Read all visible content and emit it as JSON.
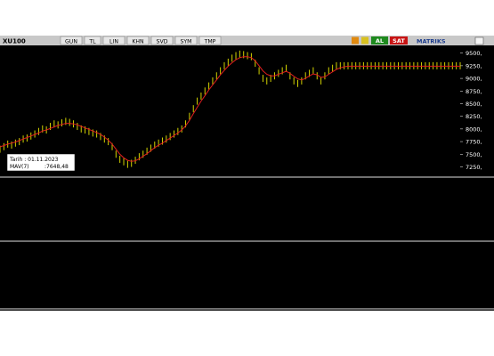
{
  "toolbar": {
    "symbol": "XU100",
    "buttons": [
      "GUN",
      "TL",
      "LIN",
      "KHN",
      "SVD",
      "SYM",
      "TMP"
    ],
    "al_label": "AL",
    "sat_label": "SAT",
    "brand": "MATRIKS",
    "colors": {
      "al": "#1e8a1e",
      "sat": "#c81414"
    }
  },
  "info_box": {
    "line1": "Tarih : 01.11.2023",
    "line2_label": "MAV(7)",
    "line2_value": ":7648,48"
  },
  "chart_data": [
    {
      "type": "line",
      "panel": "price",
      "ylim": [
        7100,
        9600
      ],
      "yticks": [
        "9500,",
        "9250,",
        "9000,",
        "8750,",
        "8500,",
        "8250,",
        "8000,",
        "7750,",
        "7500,",
        "7250,"
      ],
      "ytick_values": [
        9500,
        9250,
        9000,
        8750,
        8500,
        8250,
        8000,
        7750,
        7500,
        7250
      ],
      "x": [
        0,
        1,
        2,
        3,
        4,
        5,
        6,
        7,
        8,
        9,
        10,
        11,
        12,
        13,
        14,
        15,
        16,
        17,
        18,
        19,
        20,
        21,
        22,
        23,
        24,
        25,
        26,
        27,
        28,
        29,
        30,
        31,
        32,
        33,
        34,
        35,
        36,
        37,
        38,
        39,
        40,
        41,
        42,
        43,
        44,
        45,
        46,
        47,
        48,
        49,
        50,
        51,
        52,
        53,
        54,
        55,
        56,
        57,
        58,
        59,
        60,
        61,
        62,
        63,
        64,
        65,
        66,
        67,
        68,
        69,
        70,
        71,
        72,
        73,
        74,
        75,
        76,
        77,
        78,
        79,
        80,
        81,
        82,
        83,
        84,
        85,
        86,
        87,
        88,
        89,
        90,
        91,
        92,
        93,
        94,
        95,
        96,
        97,
        98,
        99,
        100,
        101,
        102,
        103,
        104,
        105,
        106,
        107,
        108,
        109,
        110,
        111,
        112,
        113,
        114,
        115,
        116,
        117,
        118,
        119
      ],
      "series": [
        {
          "color": "#d2d200",
          "kind": "bars",
          "values": [
            7600,
            7650,
            7700,
            7680,
            7720,
            7750,
            7800,
            7820,
            7860,
            7900,
            7950,
            8000,
            7980,
            8050,
            8100,
            8080,
            8120,
            8150,
            8130,
            8100,
            8050,
            8000,
            7980,
            7950,
            7920,
            7900,
            7850,
            7800,
            7750,
            7650,
            7500,
            7400,
            7350,
            7300,
            7320,
            7380,
            7450,
            7500,
            7560,
            7620,
            7680,
            7720,
            7760,
            7800,
            7850,
            7900,
            7950,
            8000,
            8100,
            8250,
            8400,
            8550,
            8650,
            8750,
            8850,
            8950,
            9050,
            9150,
            9250,
            9320,
            9400,
            9450,
            9480,
            9470,
            9450,
            9430,
            9300,
            9150,
            9000,
            8950,
            9000,
            9050,
            9100,
            9150,
            9200,
            9050,
            8950,
            8900,
            8950,
            9050,
            9100,
            9150,
            9050,
            8950,
            9050,
            9150,
            9200,
            9250,
            9250,
            9250,
            9250,
            9250,
            9250,
            9250,
            9250,
            9250,
            9250,
            9250,
            9250,
            9250,
            9250,
            9250,
            9250,
            9250,
            9250,
            9250,
            9250,
            9250,
            9250,
            9250,
            9250,
            9250,
            9250,
            9250,
            9250,
            9250,
            9250,
            9250,
            9250,
            9250
          ]
        },
        {
          "color": "#e01e1e",
          "kind": "line",
          "values": [
            7648,
            7670,
            7700,
            7720,
            7740,
            7770,
            7800,
            7830,
            7860,
            7890,
            7920,
            7960,
            7980,
            8010,
            8040,
            8070,
            8090,
            8110,
            8110,
            8100,
            8080,
            8050,
            8020,
            7990,
            7960,
            7930,
            7890,
            7840,
            7780,
            7700,
            7600,
            7500,
            7430,
            7380,
            7360,
            7370,
            7410,
            7460,
            7510,
            7570,
            7630,
            7680,
            7720,
            7770,
            7820,
            7870,
            7920,
            7980,
            8060,
            8170,
            8300,
            8430,
            8550,
            8660,
            8770,
            8870,
            8970,
            9070,
            9160,
            9240,
            9310,
            9370,
            9410,
            9430,
            9430,
            9410,
            9350,
            9250,
            9150,
            9080,
            9050,
            9050,
            9080,
            9110,
            9140,
            9100,
            9040,
            8990,
            8970,
            9000,
            9050,
            9090,
            9070,
            9020,
            9030,
            9080,
            9130,
            9180,
            9210,
            9230,
            9240,
            9240,
            9240,
            9240,
            9240,
            9240,
            9240,
            9240,
            9240,
            9240,
            9240,
            9240,
            9240,
            9240,
            9240,
            9240,
            9240,
            9240,
            9240,
            9240,
            9240,
            9240,
            9240,
            9240,
            9240,
            9240,
            9240,
            9240,
            9240,
            9240
          ]
        }
      ]
    }
  ]
}
